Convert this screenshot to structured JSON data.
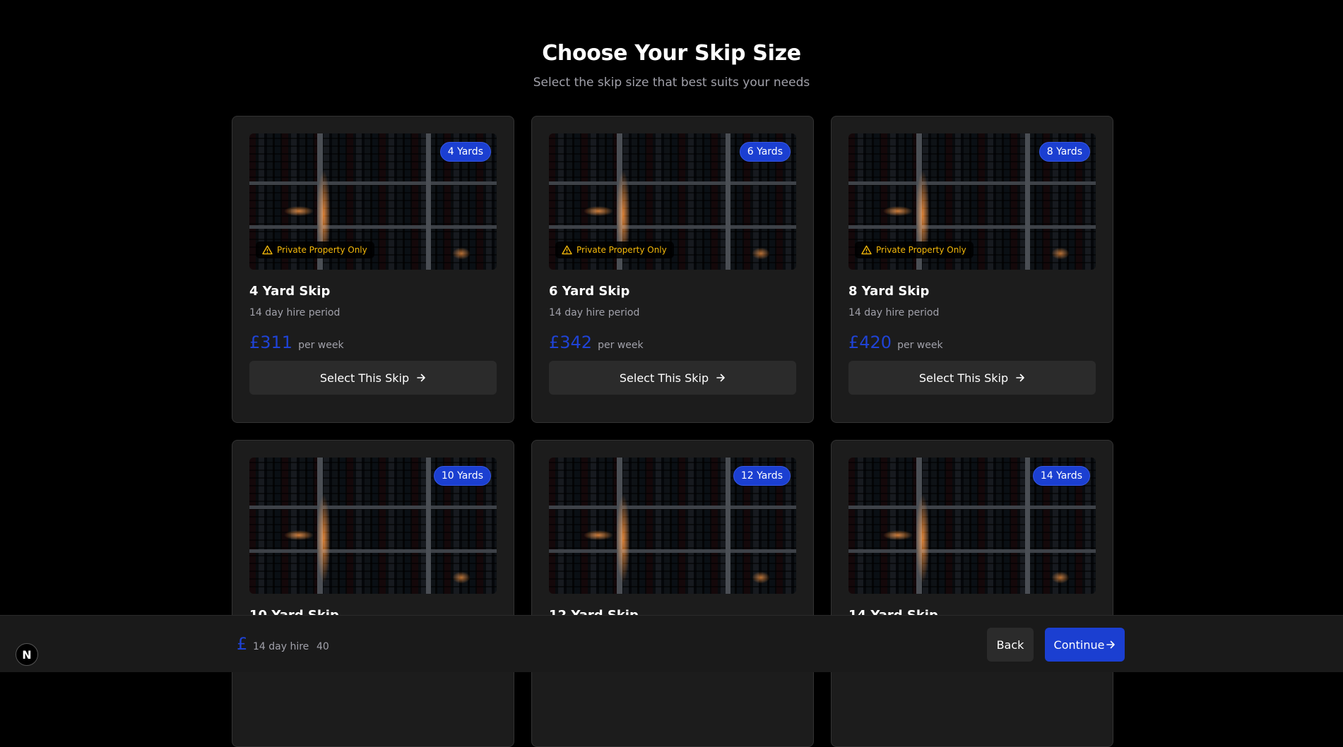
{
  "header": {
    "title": "Choose Your Skip Size",
    "subtitle": "Select the skip size that best suits your needs"
  },
  "skips": [
    {
      "badge": "4 Yards",
      "name": "4 Yard Skip",
      "period": "14 day hire period",
      "price": "£311",
      "per": "per week",
      "warning": "Private Property Only",
      "button": "Select This Skip"
    },
    {
      "badge": "6 Yards",
      "name": "6 Yard Skip",
      "period": "14 day hire period",
      "price": "£342",
      "per": "per week",
      "warning": "Private Property Only",
      "button": "Select This Skip"
    },
    {
      "badge": "8 Yards",
      "name": "8 Yard Skip",
      "period": "14 day hire period",
      "price": "£420",
      "per": "per week",
      "warning": "Private Property Only",
      "button": "Select This Skip"
    },
    {
      "badge": "10 Yards",
      "name": "10 Yard Skip"
    },
    {
      "badge": "12 Yards",
      "name": "12 Yard Skip"
    },
    {
      "badge": "14 Yards",
      "name": "14 Yard Skip"
    }
  ],
  "footer": {
    "logo": "N",
    "currency": "£",
    "hire": "14 day hire",
    "value": "40",
    "back": "Back",
    "continue": "Continue"
  },
  "colors": {
    "accent": "#1b3fd1",
    "price": "#1f43d6",
    "warning": "#f5b90a",
    "card_bg": "#1c1c1c",
    "page_bg": "#000000"
  },
  "icons": {
    "warning": "warning-triangle-icon",
    "arrow": "arrow-right-icon",
    "logo": "next-logo-icon"
  }
}
